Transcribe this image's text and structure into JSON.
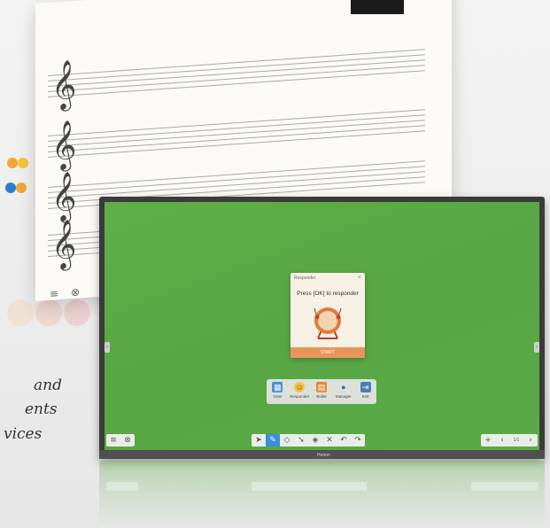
{
  "background": {
    "caption_lines": [
      "and",
      "ents",
      "vices"
    ]
  },
  "paper": {
    "clef_glyph": "𝄞",
    "tools": [
      "≡",
      "⊗"
    ]
  },
  "responder_dialog": {
    "title": "Responder",
    "close": "×",
    "prompt": "Press [OK] to responder",
    "start_label": "START"
  },
  "launcher": {
    "apps": [
      {
        "label": "Voter",
        "icon": "voter-icon",
        "glyph": "▦",
        "color": "#4a90d9"
      },
      {
        "label": "Responder",
        "icon": "responder-icon",
        "glyph": "☺",
        "color": "#e0a030"
      },
      {
        "label": "Bullet",
        "icon": "bullet-icon",
        "glyph": "▤",
        "color": "#e4893a"
      },
      {
        "label": "Manager",
        "icon": "manager-icon",
        "glyph": "●",
        "color": "#3a6ea8"
      },
      {
        "label": "Exit",
        "icon": "exit-icon",
        "glyph": "⇥",
        "color": "#4a7eb8"
      }
    ]
  },
  "toolbar": {
    "left": [
      {
        "name": "menu-icon",
        "glyph": "≡"
      },
      {
        "name": "settings-icon",
        "glyph": "⊗"
      }
    ],
    "center": [
      {
        "name": "select-icon",
        "glyph": "➤",
        "active": false
      },
      {
        "name": "pen-icon",
        "glyph": "✎",
        "active": true
      },
      {
        "name": "eraser-icon",
        "glyph": "◇",
        "active": false
      },
      {
        "name": "pointer-icon",
        "glyph": "➘",
        "active": false
      },
      {
        "name": "shapes-icon",
        "glyph": "◈",
        "active": false
      },
      {
        "name": "clear-icon",
        "glyph": "✕",
        "active": false
      },
      {
        "name": "undo-icon",
        "glyph": "↶",
        "active": false
      },
      {
        "name": "redo-icon",
        "glyph": "↷",
        "active": false
      }
    ],
    "right": {
      "add": "+",
      "prev": "‹",
      "page": "1/1",
      "next": "›"
    }
  },
  "monitor": {
    "brand": "Horion"
  },
  "colors": {
    "screen_green": "#5aa947",
    "active_tool": "#3b8fd9",
    "start_button": "#e8955c"
  }
}
